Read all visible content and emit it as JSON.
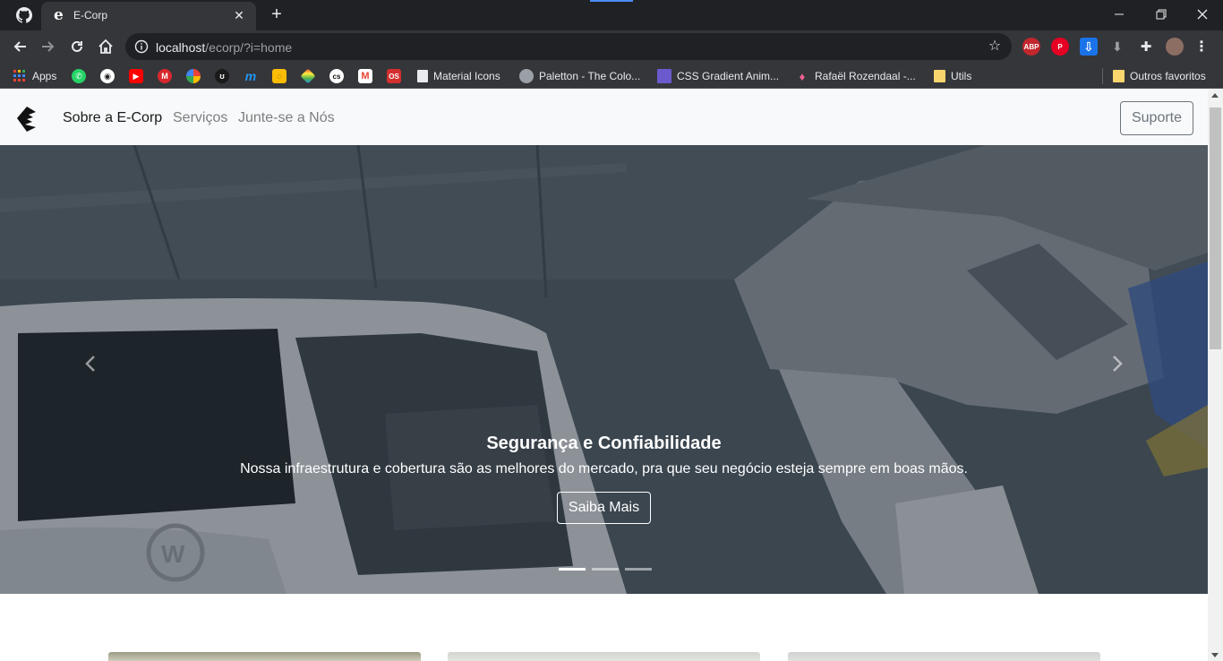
{
  "browser": {
    "tab_title": "E-Corp",
    "tab_favicon": "e",
    "url_host": "localhost",
    "url_path": "/ecorp/?i=home",
    "bookmarks": [
      {
        "label": "Apps",
        "icon": "apps-grid-icon"
      },
      {
        "label": "",
        "icon": "whatsapp-icon",
        "color": "#25d366"
      },
      {
        "label": "",
        "icon": "github-icon",
        "color": "#ffffff"
      },
      {
        "label": "",
        "icon": "youtube-icon",
        "color": "#ff0000"
      },
      {
        "label": "",
        "icon": "mega-icon",
        "color": "#d9272e"
      },
      {
        "label": "",
        "icon": "pinwheel-icon",
        "color": "#f4b400"
      },
      {
        "label": "",
        "icon": "swirl-icon",
        "color": "#222222"
      },
      {
        "label": "",
        "icon": "m-logo-icon",
        "color": "#2196f3"
      },
      {
        "label": "",
        "icon": "keep-icon",
        "color": "#fbbc04"
      },
      {
        "label": "",
        "icon": "diamond-icon",
        "color": "#7b68ee"
      },
      {
        "label": "",
        "icon": "cs-icon",
        "color": "#111111"
      },
      {
        "label": "",
        "icon": "gmail-icon",
        "color": "#ea4335"
      },
      {
        "label": "",
        "icon": "os-icon",
        "color": "#d32f2f"
      },
      {
        "label": "Material Icons",
        "icon": "material-icon",
        "color": "#e8eaed"
      },
      {
        "label": "Paletton - The Colo...",
        "icon": "paletton-icon",
        "color": "#9aa0a6"
      },
      {
        "label": "CSS Gradient Anim...",
        "icon": "gradient-icon",
        "color": "#6a5acd"
      },
      {
        "label": "Rafaël Rozendaal -...",
        "icon": "rozendaal-icon",
        "color": "#f06292"
      },
      {
        "label": "Utils",
        "icon": "folder-icon",
        "color": "#f9d56e"
      }
    ],
    "other_bookmarks": "Outros favoritos"
  },
  "site": {
    "nav": {
      "links": [
        "Sobre a E-Corp",
        "Serviços",
        "Junte-se a Nós"
      ],
      "support_label": "Suporte"
    },
    "carousel": {
      "title": "Segurança e Confiabilidade",
      "text": "Nossa infraestrutura e cobertura são as melhores do mercado, pra que seu negócio esteja sempre em boas mãos.",
      "button_label": "Saiba Mais",
      "slide_count": 3,
      "active_slide": 1
    }
  },
  "colors": {
    "chrome_dark": "#202124",
    "chrome_toolbar": "#35363a",
    "navbar_bg": "#f8f9fa",
    "support_border": "#6c757d"
  }
}
